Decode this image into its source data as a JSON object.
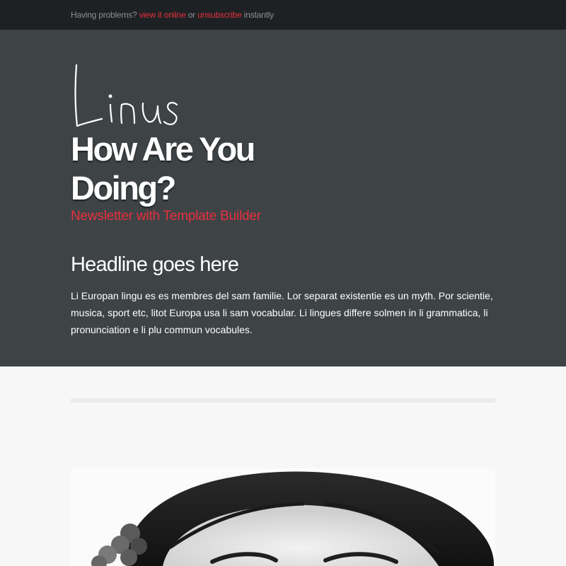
{
  "topbar": {
    "prefix": "Having problems?",
    "view_online": "view it online",
    "or": "or",
    "unsubscribe": "unsubscribe",
    "suffix": "instantly"
  },
  "hero": {
    "logo_text": "Linus",
    "title_line1": "How Are You",
    "title_line2": "Doing?",
    "subtitle": "Newsletter with Template Builder",
    "headline": "Headline goes here",
    "body": "Li Europan lingu es es membres del sam familie. Lor separat existentie es un myth. Por scientie, musica, sport etc, litot Europa usa li sam vocabular. Li lingues differe solmen in li grammatica, li pronunciation e li plu commun vocabules."
  },
  "colors": {
    "accent": "#e8303d",
    "hero_bg": "#3e4346",
    "topbar_bg": "#1e2124",
    "page_bg": "#f7f7f7"
  },
  "photo": {
    "subject": "portrait-photo"
  }
}
